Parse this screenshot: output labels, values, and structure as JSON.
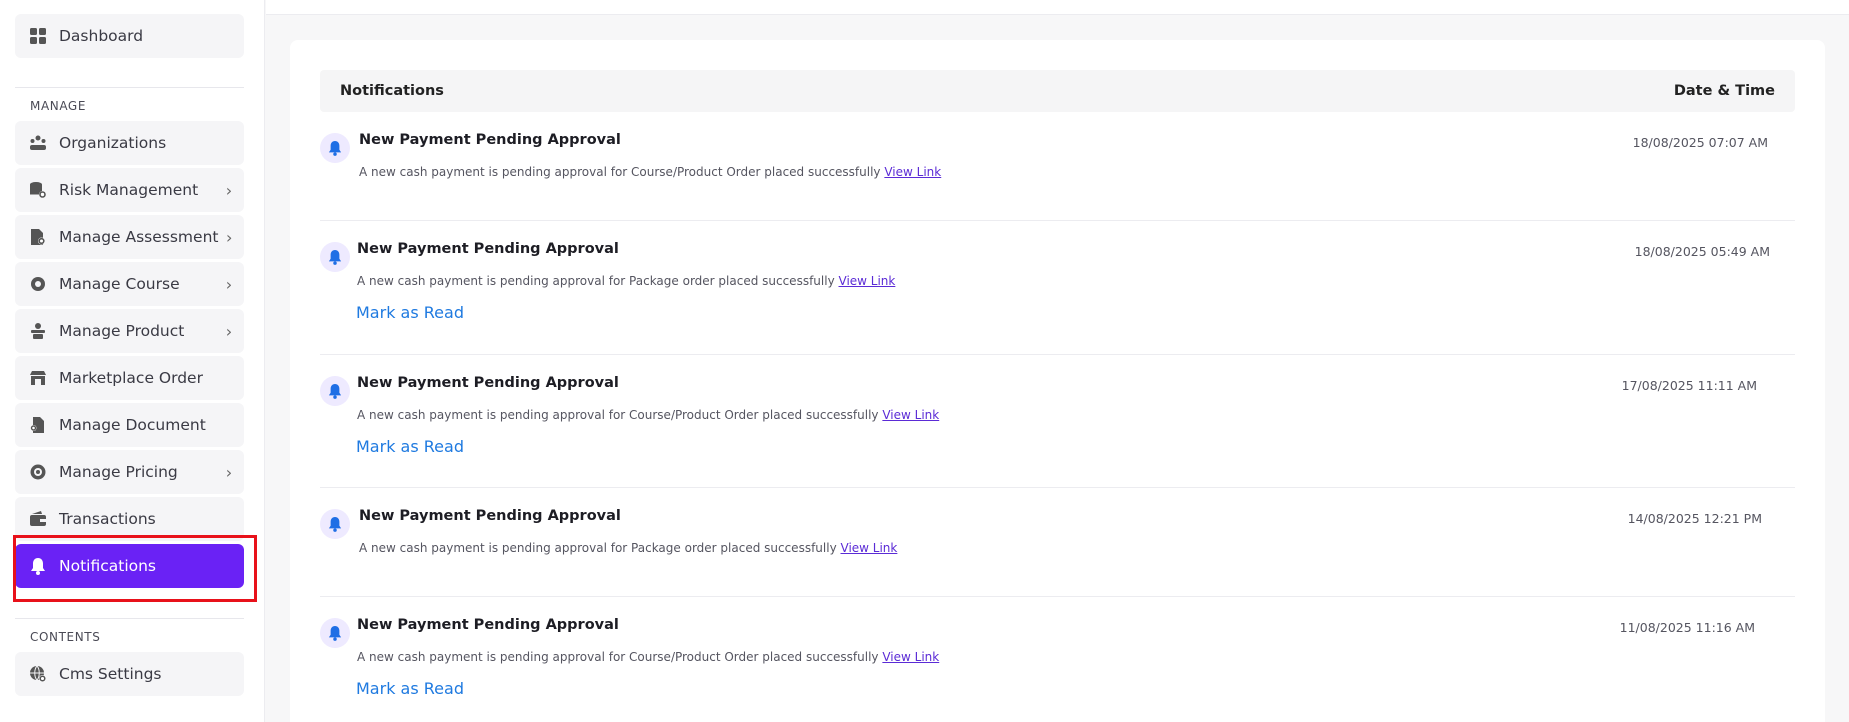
{
  "sidebar": {
    "dashboard": {
      "label": "Dashboard",
      "icon": "grid-icon"
    },
    "manage_title": "MANAGE",
    "contents_title": "CONTENTS",
    "items": [
      {
        "label": "Organizations",
        "icon": "organization-icon",
        "chevron": false
      },
      {
        "label": "Risk Management",
        "icon": "database-gear-icon",
        "chevron": true
      },
      {
        "label": "Manage Assessment",
        "icon": "document-gear-icon",
        "chevron": true
      },
      {
        "label": "Manage Course",
        "icon": "gear-icon",
        "chevron": true
      },
      {
        "label": "Manage Product",
        "icon": "product-icon",
        "chevron": true
      },
      {
        "label": "Marketplace Order",
        "icon": "store-icon",
        "chevron": false
      },
      {
        "label": "Manage Document",
        "icon": "document-icon",
        "chevron": false
      },
      {
        "label": "Manage Pricing",
        "icon": "pricing-gear-icon",
        "chevron": true
      },
      {
        "label": "Transactions",
        "icon": "wallet-icon",
        "chevron": false
      },
      {
        "label": "Notifications",
        "icon": "bell-icon",
        "chevron": false,
        "active": true
      }
    ],
    "cms": {
      "label": "Cms Settings",
      "icon": "globe-gear-icon"
    },
    "active_color": "#6a22f5",
    "highlight_color": "#e8111a"
  },
  "table": {
    "col_notifications": "Notifications",
    "col_datetime": "Date & Time"
  },
  "notifications": [
    {
      "title": "New Payment Pending Approval",
      "message": "A new cash payment is pending approval for Course/Product Order placed successfully",
      "link": "View Link",
      "date": "18/08/2025 07:07 AM",
      "mark": ""
    },
    {
      "title": "New Payment Pending Approval",
      "message": "A new cash payment is pending approval for Package order placed successfully",
      "link": "View Link",
      "date": "18/08/2025 05:49 AM",
      "mark": "Mark as Read"
    },
    {
      "title": "New Payment Pending Approval",
      "message": "A new cash payment is pending approval for Course/Product Order placed successfully",
      "link": "View Link",
      "date": "17/08/2025 11:11 AM",
      "mark": "Mark as Read"
    },
    {
      "title": "New Payment Pending Approval",
      "message": "A new cash payment is pending approval for Package order placed successfully",
      "link": "View Link",
      "date": "14/08/2025 12:21 PM",
      "mark": ""
    },
    {
      "title": "New Payment Pending Approval",
      "message": "A new cash payment is pending approval for Course/Product Order placed successfully",
      "link": "View Link",
      "date": "11/08/2025 11:16 AM",
      "mark": "Mark as Read"
    }
  ]
}
